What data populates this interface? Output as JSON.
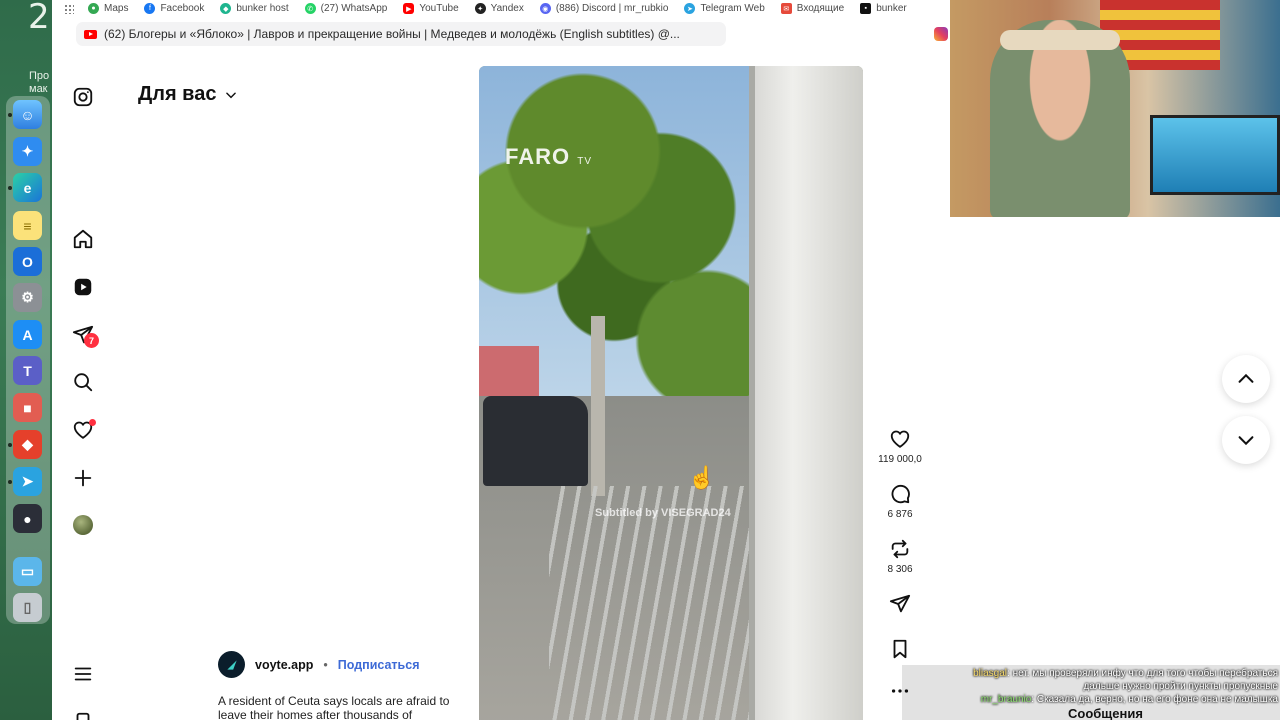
{
  "desktop": {
    "clock_digit": "2",
    "widget_text": "Про\nмак"
  },
  "bookmarks": [
    {
      "label": "Maps",
      "icon": "maps-icon",
      "color": "#34a853"
    },
    {
      "label": "Facebook",
      "icon": "facebook-icon",
      "color": "#1877f2"
    },
    {
      "label": "bunker host",
      "icon": "bunker-icon",
      "color": "#1fb58f"
    },
    {
      "label": "(27) WhatsApp",
      "icon": "whatsapp-icon",
      "color": "#25d366"
    },
    {
      "label": "YouTube",
      "icon": "youtube-icon",
      "color": "#ff0000"
    },
    {
      "label": "Yandex",
      "icon": "yandex-icon",
      "color": "#222222"
    },
    {
      "label": "(886) Discord | mr_rubkio",
      "icon": "discord-icon",
      "color": "#5865f2"
    },
    {
      "label": "Telegram Web",
      "icon": "telegram-icon",
      "color": "#2aa3e0"
    },
    {
      "label": "Входящие",
      "icon": "mail-icon",
      "color": "#e64a3b"
    },
    {
      "label": "bunker",
      "icon": "bunker-icon",
      "color": "#111111"
    }
  ],
  "tab": {
    "title": "(62) Блогеры и «Яблоко» | Лавров и прекращение войны | Медведев и молодёжь (English subtitles) @..."
  },
  "feed": {
    "title": "Для вас"
  },
  "nav": {
    "notifications_count": "7"
  },
  "reel": {
    "watermark": "FARO",
    "watermark_sub": "TV",
    "subtitled": "Subtitled by VISEGRAD24"
  },
  "post": {
    "author": "voyte.app",
    "separator": "•",
    "follow": "Подписаться",
    "caption": "A resident of Ceuta says locals are afraid to leave their homes after thousands of"
  },
  "actions": {
    "likes": "119 000,0",
    "comments": "6 876",
    "reposts": "8 306"
  },
  "chat": {
    "line1_user": "bliasgal",
    "line1_text": ": нет. мы проверяли инфу что для того чтобы перебраться",
    "line2_text": "дальше нужно пройти пункты пропускные",
    "line3_user": "mr_braunio",
    "line3_text": ": Сказала да, верно, но на его фоне она не малышка",
    "messages_label": "Сообщения"
  },
  "colors": {
    "accent_link": "#3d6ad6",
    "badge_red": "#ff3040"
  }
}
